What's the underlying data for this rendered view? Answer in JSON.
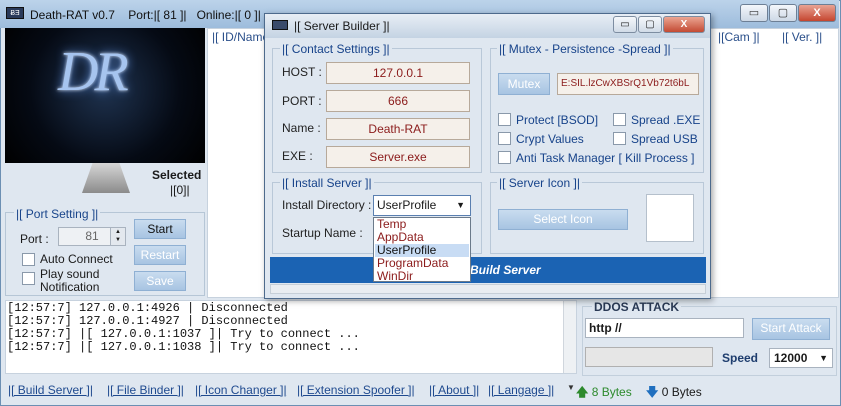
{
  "main_window": {
    "title": "Death-RAT v0.7",
    "port_text": "Port:|[ 81 ]|",
    "online_text": "Online:|[ 0 ]|",
    "min": "▭",
    "max": "▢",
    "close": "X",
    "logo_text": "DR"
  },
  "selected": {
    "label": "Selected",
    "count": "|[0]|"
  },
  "list_headers": [
    "|[ ID/Name",
    "|[Cam ]|",
    "|[ Ver. ]|"
  ],
  "port_setting": {
    "heading": "|[ Port Setting ]|",
    "port_label": "Port :",
    "port_value": "81",
    "auto_connect": "Auto Connect",
    "play_sound": "Play sound Notification",
    "start": "Start",
    "restart": "Restart",
    "save": "Save"
  },
  "log": [
    "[12:57:7]     127.0.0.1:4926  |  Disconnected",
    "[12:57:7]     127.0.0.1:4927  |  Disconnected",
    "[12:57:7]    |[ 127.0.0.1:1037 ]| Try to connect ...",
    "[12:57:7]    |[ 127.0.0.1:1038 ]| Try to connect ..."
  ],
  "ddos": {
    "title": "DDOS ATTACK",
    "url": "http //",
    "start_attack": "Start Attack",
    "speed_label": "Speed",
    "speed_value": "12000"
  },
  "nav": [
    "|[ Build Server ]|",
    "|[ File Binder ]|",
    "|[ Icon Changer ]|",
    "|[ Extension Spoofer ]|",
    "|[ About ]|",
    "|[ Langage ]|"
  ],
  "bytes": {
    "up": "8 Bytes",
    "down": "0 Bytes"
  },
  "builder": {
    "title": "|[ Server Builder ]|",
    "contact_heading": "|[ Contact Settings ]|",
    "host_label": "HOST :",
    "host_value": "127.0.0.1",
    "port_label": "PORT :",
    "port_value": "666",
    "name_label": "Name :",
    "name_value": "Death-RAT",
    "exe_label": "EXE  :",
    "exe_value": "Server.exe",
    "mutex_heading": "|[ Mutex - Persistence -Spread ]|",
    "mutex_button": "Mutex",
    "mutex_value": "E:SIL.lzCwXBSrQ1Vb72t6bL",
    "protect": "Protect [BSOD]",
    "crypt": "Crypt Values",
    "anti_task": "Anti Task Manager [ Kill Process ]",
    "spread_exe": "Spread .EXE",
    "spread_usb": "Spread USB",
    "install_heading": "|[ Install Server ]|",
    "install_dir_label": "Install Directory :",
    "install_dir_value": "UserProfile",
    "startup_label": "Startup Name :",
    "icon_heading": "|[ Server Icon ]|",
    "select_icon": "Select Icon",
    "build_button": "Build Server",
    "dropdown_options": [
      "Temp",
      "AppData",
      "UserProfile",
      "ProgramData",
      "WinDir"
    ]
  }
}
